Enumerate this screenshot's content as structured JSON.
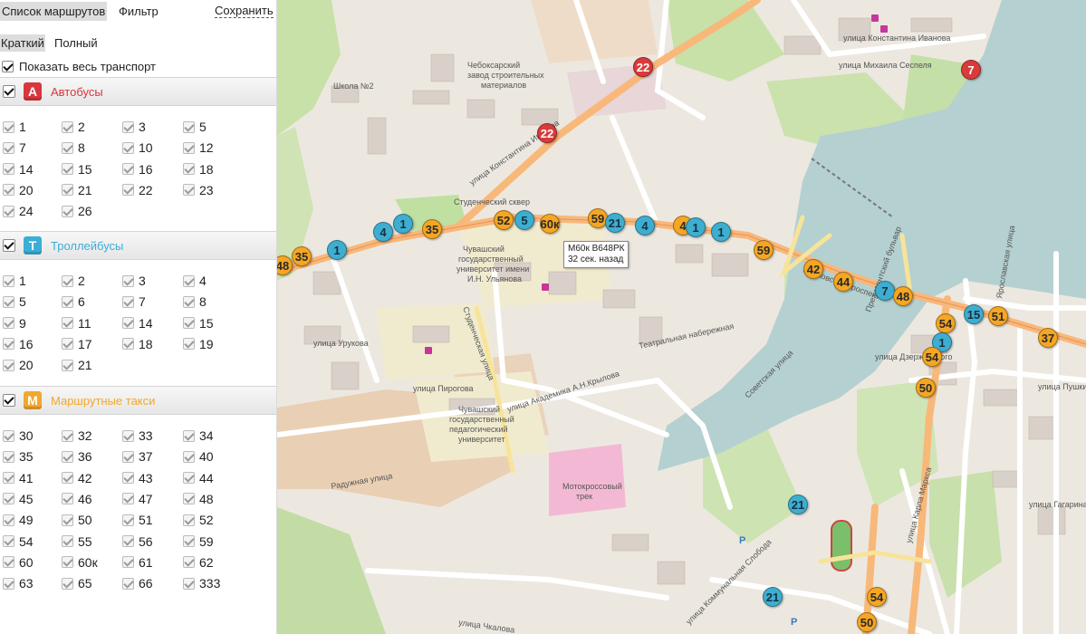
{
  "panel": {
    "tabs": {
      "routes": "Список маршрутов",
      "filter": "Фильтр",
      "save": "Сохранить"
    },
    "modes": {
      "short": "Краткий",
      "full": "Полный"
    },
    "show_all": "Показать весь транспорт",
    "sections": [
      {
        "icon_letter": "А",
        "title": "Автобусы",
        "color": "#d9363e",
        "title_color": "#d9363e",
        "routes": [
          "1",
          "2",
          "3",
          "5",
          "7",
          "8",
          "10",
          "12",
          "14",
          "15",
          "16",
          "18",
          "20",
          "21",
          "22",
          "23",
          "24",
          "26"
        ]
      },
      {
        "icon_letter": "Т",
        "title": "Троллейбусы",
        "color": "#3aaed6",
        "title_color": "#3aaed6",
        "routes": [
          "1",
          "2",
          "3",
          "4",
          "5",
          "6",
          "7",
          "8",
          "9",
          "11",
          "14",
          "15",
          "16",
          "17",
          "18",
          "19",
          "20",
          "21"
        ]
      },
      {
        "icon_letter": "М",
        "title": "Маршрутные такси",
        "color": "#f0a830",
        "title_color": "#f0a830",
        "routes": [
          "30",
          "32",
          "33",
          "34",
          "35",
          "36",
          "37",
          "40",
          "41",
          "42",
          "43",
          "44",
          "45",
          "46",
          "47",
          "48",
          "49",
          "50",
          "51",
          "52",
          "54",
          "55",
          "56",
          "59",
          "60",
          "60к",
          "61",
          "62",
          "63",
          "65",
          "66",
          "333"
        ]
      }
    ]
  },
  "map": {
    "tooltip": {
      "line1": "М60к В648РК",
      "line2": "32 сек. назад"
    },
    "labels": [
      "Чебоксарский завод строительных материалов",
      "Школа №2",
      "Студенческий сквер",
      "Чувашский государственный университет имени И.Н. Ульянова",
      "Чувашский государственный педагогический университет",
      "Мотокроссовый трек",
      "улица Пирогова",
      "улица Академика А.Н.Крылова",
      "улица Константина Иванова",
      "улица Михаила Сеспеля",
      "Президентский бульвар",
      "улица Карла Маркса",
      "Ярославская улица",
      "улица Дзержинского",
      "улица Чкалова",
      "улица Коммунальная Слобода",
      "Московский проспект",
      "Театральная набережная",
      "Советская улица",
      "улица Урукова",
      "Радужная улица",
      "Студенческая улица",
      "улица Пушкина",
      "улица Гагарина"
    ],
    "markers": [
      {
        "n": "22",
        "c": "rd"
      },
      {
        "n": "22",
        "c": "rd"
      },
      {
        "n": "7",
        "c": "rd"
      },
      {
        "n": "48",
        "c": "or"
      },
      {
        "n": "35",
        "c": "or"
      },
      {
        "n": "1",
        "c": "bl"
      },
      {
        "n": "4",
        "c": "bl"
      },
      {
        "n": "1",
        "c": "bl"
      },
      {
        "n": "35",
        "c": "or"
      },
      {
        "n": "52",
        "c": "or"
      },
      {
        "n": "5",
        "c": "bl"
      },
      {
        "n": "60к",
        "c": "or"
      },
      {
        "n": "59",
        "c": "or"
      },
      {
        "n": "21",
        "c": "bl"
      },
      {
        "n": "4",
        "c": "bl"
      },
      {
        "n": "4",
        "c": "or"
      },
      {
        "n": "1",
        "c": "bl"
      },
      {
        "n": "1",
        "c": "bl"
      },
      {
        "n": "59",
        "c": "or"
      },
      {
        "n": "42",
        "c": "or"
      },
      {
        "n": "44",
        "c": "or"
      },
      {
        "n": "7",
        "c": "bl"
      },
      {
        "n": "48",
        "c": "or"
      },
      {
        "n": "54",
        "c": "or"
      },
      {
        "n": "15",
        "c": "bl"
      },
      {
        "n": "51",
        "c": "or"
      },
      {
        "n": "1",
        "c": "bl"
      },
      {
        "n": "37",
        "c": "or"
      },
      {
        "n": "54",
        "c": "or"
      },
      {
        "n": "50",
        "c": "or"
      },
      {
        "n": "21",
        "c": "bl"
      },
      {
        "n": "21",
        "c": "bl"
      },
      {
        "n": "54",
        "c": "or"
      },
      {
        "n": "50",
        "c": "or"
      }
    ]
  }
}
